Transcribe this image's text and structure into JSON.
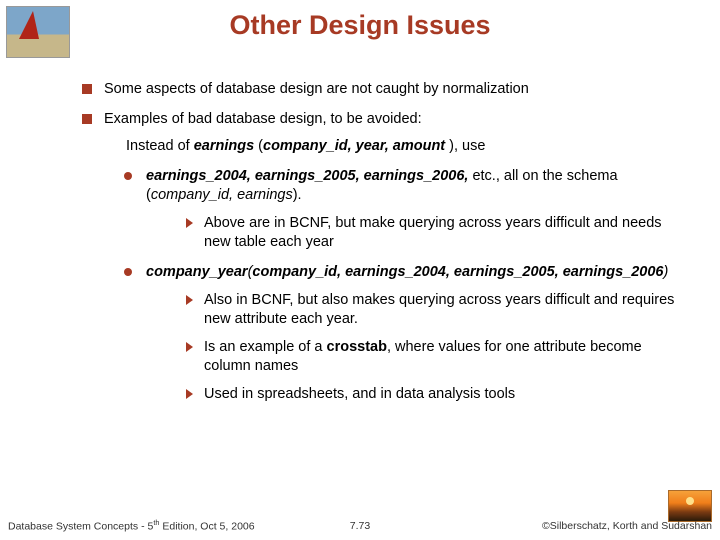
{
  "title": "Other Design Issues",
  "bullets": {
    "b1": "Some aspects of database design are not caught by normalization",
    "b2": "Examples of bad database design, to be avoided:",
    "sub_intro_a": "Instead of ",
    "sub_intro_b": "earnings",
    "sub_intro_c": " (",
    "sub_intro_d": "company_id, year, amount",
    "sub_intro_e": " ), use",
    "s1a": "earnings_2004, earnings_2005, earnings_2006,",
    "s1b": " etc., all on the schema (",
    "s1c": "company_id, earnings",
    "s1d": ").",
    "s1_sub": "Above are in BCNF, but make querying across years difficult and needs new table each year",
    "s2a": "company_year",
    "s2b": "(",
    "s2c": "company_id, earnings_2004, earnings_2005, earnings_2006",
    "s2d": ")",
    "s2_sub1": "Also in BCNF, but also makes querying across years difficult and requires new attribute each year.",
    "s2_sub2a": "Is an example of a ",
    "s2_sub2b": "crosstab",
    "s2_sub2c": ", where values for one attribute become column names",
    "s2_sub3": "Used in spreadsheets, and in data analysis tools"
  },
  "footer": {
    "left_a": "Database System Concepts - 5",
    "left_b": "th",
    "left_c": " Edition, Oct 5, 2006",
    "center": "7.73",
    "right": "©Silberschatz, Korth and Sudarshan"
  }
}
